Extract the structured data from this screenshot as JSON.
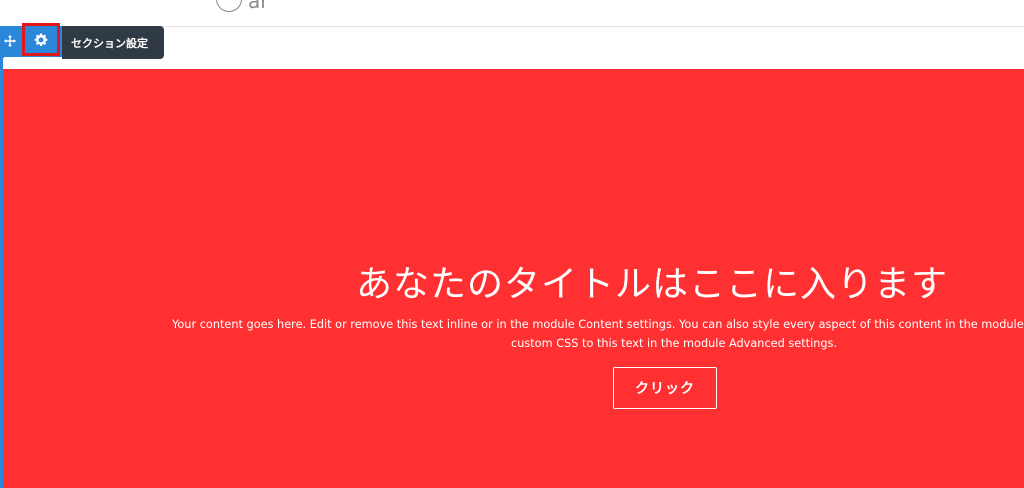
{
  "header": {
    "logo_text": "ar"
  },
  "toolbar": {
    "move_icon": "move-icon",
    "settings_icon": "gear-icon",
    "tooltip_label": "セクション設定"
  },
  "section": {
    "background_color": "#ff3031",
    "outline_color": "#2b87da",
    "title": "あなたのタイトルはここに入ります",
    "body_line1": "Your content goes here. Edit or remove this text inline or in the module Content settings. You can also style every aspect of this content in the module Design",
    "body_line2": "custom CSS to this text in the module Advanced settings.",
    "button_label": "クリック"
  },
  "highlight_color": "#e2161b"
}
